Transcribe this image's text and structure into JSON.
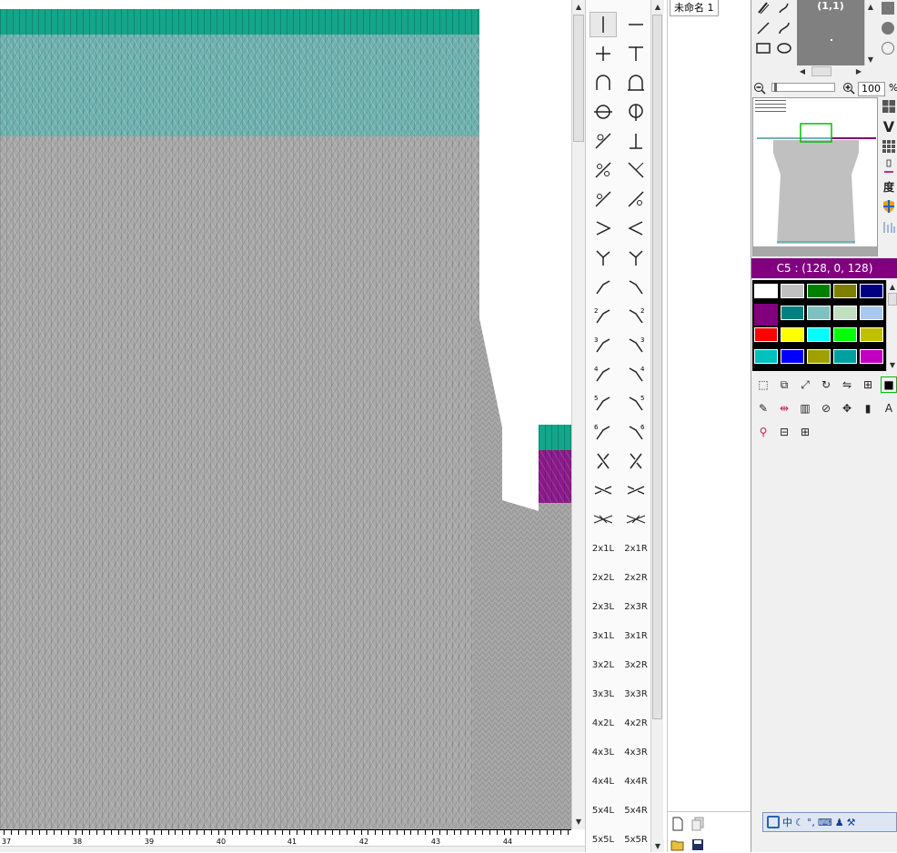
{
  "document": {
    "tab_title": "未命名 1"
  },
  "ruler": {
    "labels": [
      "37",
      "38",
      "39",
      "40",
      "41",
      "42",
      "43",
      "44"
    ]
  },
  "stitches": {
    "text_items": [
      [
        "2x1L",
        "2x1R"
      ],
      [
        "2x2L",
        "2x2R"
      ],
      [
        "2x3L",
        "2x3R"
      ],
      [
        "3x1L",
        "3x1R"
      ],
      [
        "3x2L",
        "3x2R"
      ],
      [
        "3x3L",
        "3x3R"
      ],
      [
        "4x2L",
        "4x2R"
      ],
      [
        "4x3L",
        "4x3R"
      ],
      [
        "4x4L",
        "4x4R"
      ],
      [
        "5x4L",
        "5x4R"
      ],
      [
        "5x5L",
        "5x5R"
      ]
    ]
  },
  "preview": {
    "coords": "(1,1)"
  },
  "zoom": {
    "value": "100",
    "unit": "%"
  },
  "color_panel": {
    "selected_label": "C5 : (128, 0, 128)",
    "selected_color": "#800080"
  },
  "palette": [
    [
      "#ffffff",
      "#c0c0c0",
      "#008000",
      "#808000",
      "#000080"
    ],
    [
      "#800080",
      "#008080",
      "#80c0c0",
      "#c0e0c0",
      "#a8c8f0"
    ],
    [
      "#ff0000",
      "#ffff00",
      "#00ffff",
      "#00ff00",
      "#c0c000"
    ],
    [
      "#00c0c0",
      "#0000ff",
      "#a0a000",
      "#00a0a0",
      "#c000c0"
    ]
  ],
  "side_labels": {
    "degree": "度"
  },
  "ime": {
    "mode": "中"
  },
  "colors": {
    "knit_gray": "#a9a9a9",
    "knit_teal": "#6fb3b0",
    "knit_green": "#14a58a",
    "knit_purple": "#8a1a8a"
  }
}
